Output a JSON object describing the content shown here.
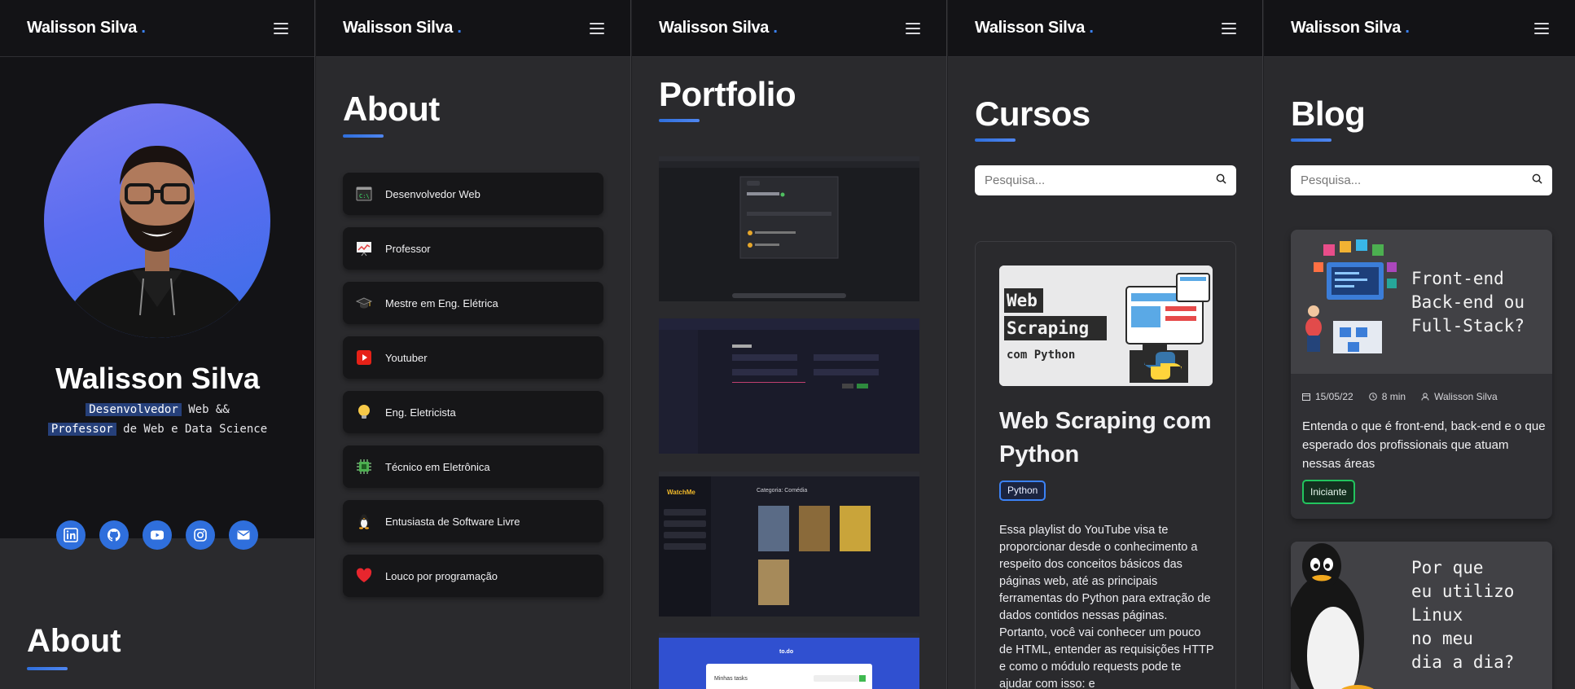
{
  "brand": {
    "name": "Walisson Silva",
    "dot": "."
  },
  "profile": {
    "name": "Walisson Silva",
    "role_1_highlight": "Desenvolvedor",
    "role_1_rest": "Web &&",
    "role_2_highlight": "Professor",
    "role_2_rest": "de Web e Data Science",
    "socials": [
      {
        "icon": "linkedin-icon"
      },
      {
        "icon": "github-icon"
      },
      {
        "icon": "youtube-icon"
      },
      {
        "icon": "instagram-icon"
      },
      {
        "icon": "mail-icon"
      }
    ],
    "next_section": "About"
  },
  "about": {
    "title": "About",
    "items": [
      {
        "label": "Desenvolvedor Web",
        "icon": "terminal-icon"
      },
      {
        "label": "Professor",
        "icon": "chart-presentation-icon"
      },
      {
        "label": "Mestre em Eng. Elétrica",
        "icon": "graduation-cap-icon"
      },
      {
        "label": "Youtuber",
        "icon": "youtube-icon"
      },
      {
        "label": "Eng. Eletricista",
        "icon": "light-bulb-icon"
      },
      {
        "label": "Técnico em Eletrônica",
        "icon": "chip-icon"
      },
      {
        "label": "Entusiasta de Software Livre",
        "icon": "penguin-icon"
      },
      {
        "label": "Louco por programação",
        "icon": "heart-icon"
      }
    ]
  },
  "portfolio": {
    "title": "Portfolio",
    "shots": [
      {
        "name": "portfolio-shot-task-app",
        "theme": "dark"
      },
      {
        "name": "portfolio-shot-django-form",
        "theme": "dark"
      },
      {
        "name": "portfolio-shot-watchme",
        "theme": "dark",
        "app_label": "WatchMe",
        "page_label": "Categoria: Comédia"
      },
      {
        "name": "portfolio-shot-todo",
        "theme": "blue",
        "app_label": "to.do",
        "page_label": "Minhas tasks"
      }
    ]
  },
  "cursos": {
    "title": "Cursos",
    "search_placeholder": "Pesquisa...",
    "course": {
      "thumb_text_1": "Web",
      "thumb_text_2": "Scraping",
      "thumb_text_3": "com Python",
      "title": "Web Scraping com Python",
      "tag": "Python",
      "description": "Essa playlist do YouTube visa te proporcionar desde o conhecimento a respeito dos conceitos básicos das páginas web, até as principais ferramentas do Python para extração de dados contidos nessas páginas. Portanto, você vai conhecer um pouco de HTML, entender as requisições HTTP e como o módulo requests pode te ajudar com isso: e"
    }
  },
  "blog": {
    "title": "Blog",
    "search_placeholder": "Pesquisa...",
    "posts": [
      {
        "hero_text": "Front-end\nBack-end ou\nFull-Stack?",
        "date": "15/05/22",
        "read_time": "8 min",
        "author": "Walisson Silva",
        "excerpt": "Entenda o que é front-end, back-end e o que esperado dos profissionais que atuam nessas áreas",
        "level": "Iniciante"
      },
      {
        "hero_text": "Por que\neu utilizo\nLinux\nno meu\ndia a dia?"
      }
    ]
  },
  "colors": {
    "accent": "#3b82f6",
    "panel_dark": "#131316",
    "panel_mid": "#2a2a2d",
    "tag_green": "#22c55e"
  }
}
